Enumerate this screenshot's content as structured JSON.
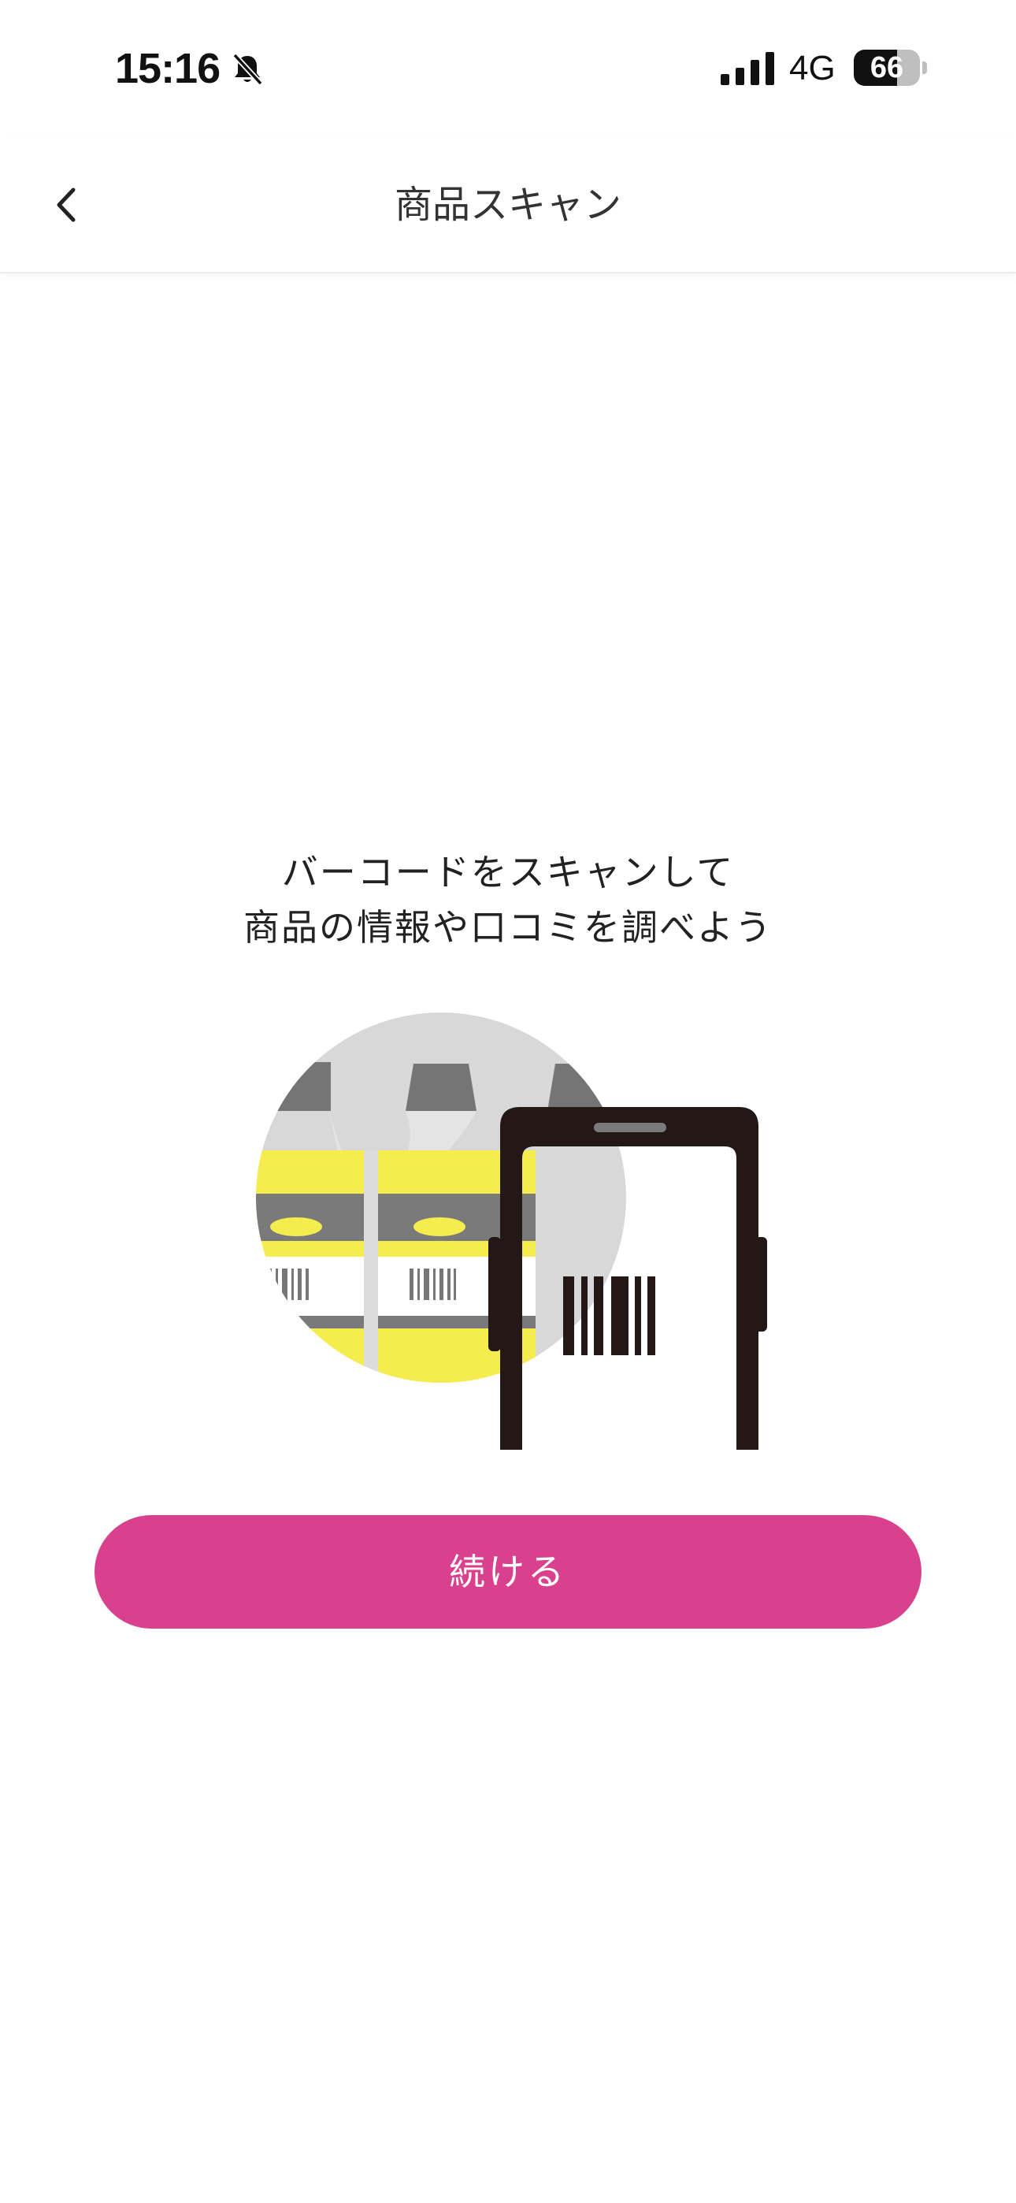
{
  "status_bar": {
    "time": "15:16",
    "network": "4G",
    "battery_level": "66"
  },
  "nav": {
    "title": "商品スキャン",
    "back_icon": "chevron-left-icon"
  },
  "main": {
    "instruction_line1": "バーコードをスキャンして",
    "instruction_line2": "商品の情報や口コミを調べよう",
    "illustration": "barcode-scan-illustration",
    "continue_label": "続ける"
  },
  "colors": {
    "accent": "#d9418f",
    "illustration_yellow": "#f5ec4e",
    "illustration_gray": "#777777",
    "phone_dark": "#231815"
  }
}
